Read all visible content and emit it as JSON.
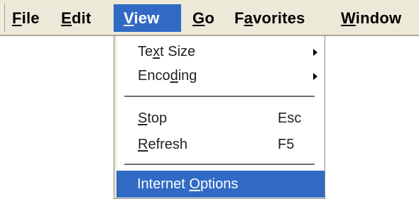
{
  "menubar": {
    "items": [
      {
        "id": "file",
        "pre": "",
        "acc": "F",
        "post": "ile",
        "active": false
      },
      {
        "id": "edit",
        "pre": "",
        "acc": "E",
        "post": "dit",
        "active": false
      },
      {
        "id": "view",
        "pre": "",
        "acc": "V",
        "post": "iew",
        "active": true
      },
      {
        "id": "go",
        "pre": "",
        "acc": "G",
        "post": "o",
        "active": false
      },
      {
        "id": "favorites",
        "pre": "F",
        "acc": "a",
        "post": "vorites",
        "active": false
      },
      {
        "id": "window",
        "pre": "",
        "acc": "W",
        "post": "indow",
        "active": false
      }
    ]
  },
  "view_menu": {
    "items": [
      {
        "id": "text-size",
        "pre": "Te",
        "acc": "x",
        "post": "t Size",
        "shortcut": "",
        "submenu": true
      },
      {
        "id": "encoding",
        "pre": "Enco",
        "acc": "d",
        "post": "ing",
        "shortcut": "",
        "submenu": true
      },
      {
        "id": "stop",
        "pre": "",
        "acc": "S",
        "post": "top",
        "shortcut": "Esc",
        "submenu": false
      },
      {
        "id": "refresh",
        "pre": "",
        "acc": "R",
        "post": "efresh",
        "shortcut": "F5",
        "submenu": false
      },
      {
        "id": "internet-options",
        "pre": "Internet ",
        "acc": "O",
        "post": "ptions",
        "shortcut": "",
        "submenu": false,
        "highlighted": true
      }
    ]
  },
  "colors": {
    "menubar_bg": "#ece9d8",
    "highlight_bg": "#316ac5",
    "highlight_text": "#ffffff",
    "menu_bg": "#ffffff"
  }
}
